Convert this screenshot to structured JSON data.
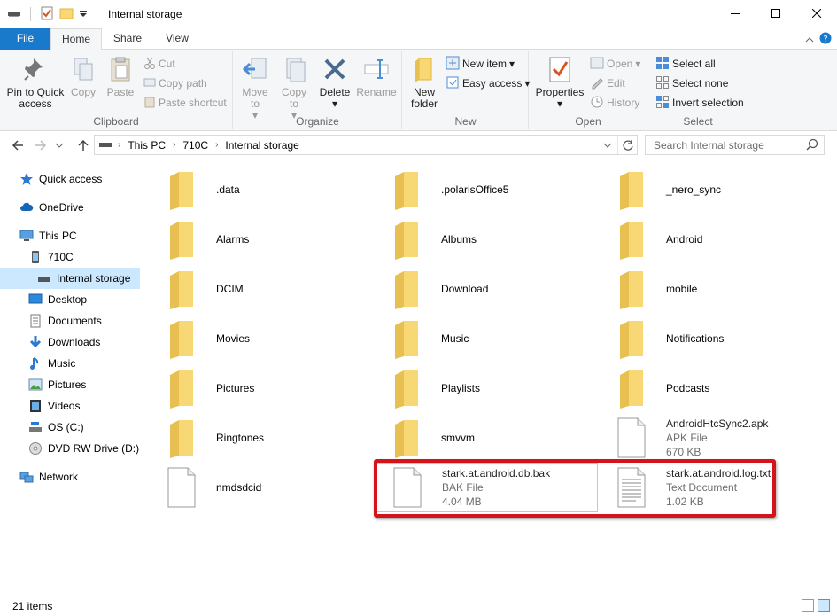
{
  "window": {
    "title": "Internal storage"
  },
  "tabs": [
    {
      "label": "File"
    },
    {
      "label": "Home"
    },
    {
      "label": "Share"
    },
    {
      "label": "View"
    }
  ],
  "ribbon": {
    "clipboard": {
      "label": "Clipboard",
      "pin": "Pin to Quick access",
      "copy": "Copy",
      "paste": "Paste",
      "cut": "Cut",
      "copy_path": "Copy path",
      "paste_shortcut": "Paste shortcut"
    },
    "organize": {
      "label": "Organize",
      "move_to": "Move to",
      "copy_to": "Copy to",
      "delete": "Delete",
      "rename": "Rename"
    },
    "new": {
      "label": "New",
      "new_folder": "New folder",
      "new_item": "New item",
      "easy_access": "Easy access"
    },
    "open": {
      "label": "Open",
      "properties": "Properties",
      "open": "Open",
      "edit": "Edit",
      "history": "History"
    },
    "select": {
      "label": "Select",
      "select_all": "Select all",
      "select_none": "Select none",
      "invert": "Invert selection"
    }
  },
  "address": {
    "crumbs": [
      "This PC",
      "710C",
      "Internal storage"
    ],
    "search_placeholder": "Search Internal storage"
  },
  "nav": {
    "items": [
      {
        "label": "Quick access",
        "icon": "star-icon"
      },
      {
        "label": "OneDrive",
        "icon": "cloud-icon"
      },
      {
        "label": "This PC",
        "icon": "computer-icon"
      },
      {
        "label": "710C",
        "icon": "phone-icon"
      },
      {
        "label": "Internal storage",
        "icon": "drive-icon"
      },
      {
        "label": "Desktop",
        "icon": "desktop-icon"
      },
      {
        "label": "Documents",
        "icon": "documents-icon"
      },
      {
        "label": "Downloads",
        "icon": "download-icon"
      },
      {
        "label": "Music",
        "icon": "music-icon"
      },
      {
        "label": "Pictures",
        "icon": "pictures-icon"
      },
      {
        "label": "Videos",
        "icon": "videos-icon"
      },
      {
        "label": "OS (C:)",
        "icon": "windows-drive-icon"
      },
      {
        "label": "DVD RW Drive (D:) T",
        "icon": "dvd-icon"
      },
      {
        "label": "Network",
        "icon": "network-icon"
      }
    ]
  },
  "files": [
    {
      "name": ".data",
      "type": "folder"
    },
    {
      "name": ".polarisOffice5",
      "type": "folder"
    },
    {
      "name": "_nero_sync",
      "type": "folder"
    },
    {
      "name": "Alarms",
      "type": "folder"
    },
    {
      "name": "Albums",
      "type": "folder"
    },
    {
      "name": "Android",
      "type": "folder"
    },
    {
      "name": "DCIM",
      "type": "folder"
    },
    {
      "name": "Download",
      "type": "folder"
    },
    {
      "name": "mobile",
      "type": "folder"
    },
    {
      "name": "Movies",
      "type": "folder"
    },
    {
      "name": "Music",
      "type": "folder"
    },
    {
      "name": "Notifications",
      "type": "folder"
    },
    {
      "name": "Pictures",
      "type": "folder"
    },
    {
      "name": "Playlists",
      "type": "folder"
    },
    {
      "name": "Podcasts",
      "type": "folder"
    },
    {
      "name": "Ringtones",
      "type": "folder"
    },
    {
      "name": "smvvm",
      "type": "folder"
    },
    {
      "name": "AndroidHtcSync2.apk",
      "type": "file",
      "kind": "APK File",
      "size": "670 KB"
    },
    {
      "name": "nmdsdcid",
      "type": "file"
    },
    {
      "name": "stark.at.android.db.bak",
      "type": "file",
      "kind": "BAK File",
      "size": "4.04 MB"
    },
    {
      "name": "stark.at.android.log.txt",
      "type": "text",
      "kind": "Text Document",
      "size": "1.02 KB"
    }
  ],
  "status": {
    "count": "21 items"
  },
  "colors": {
    "accent": "#1979ca",
    "highlight": "#d4131b",
    "folder": "#f8d775",
    "selection": "#cce8ff"
  }
}
